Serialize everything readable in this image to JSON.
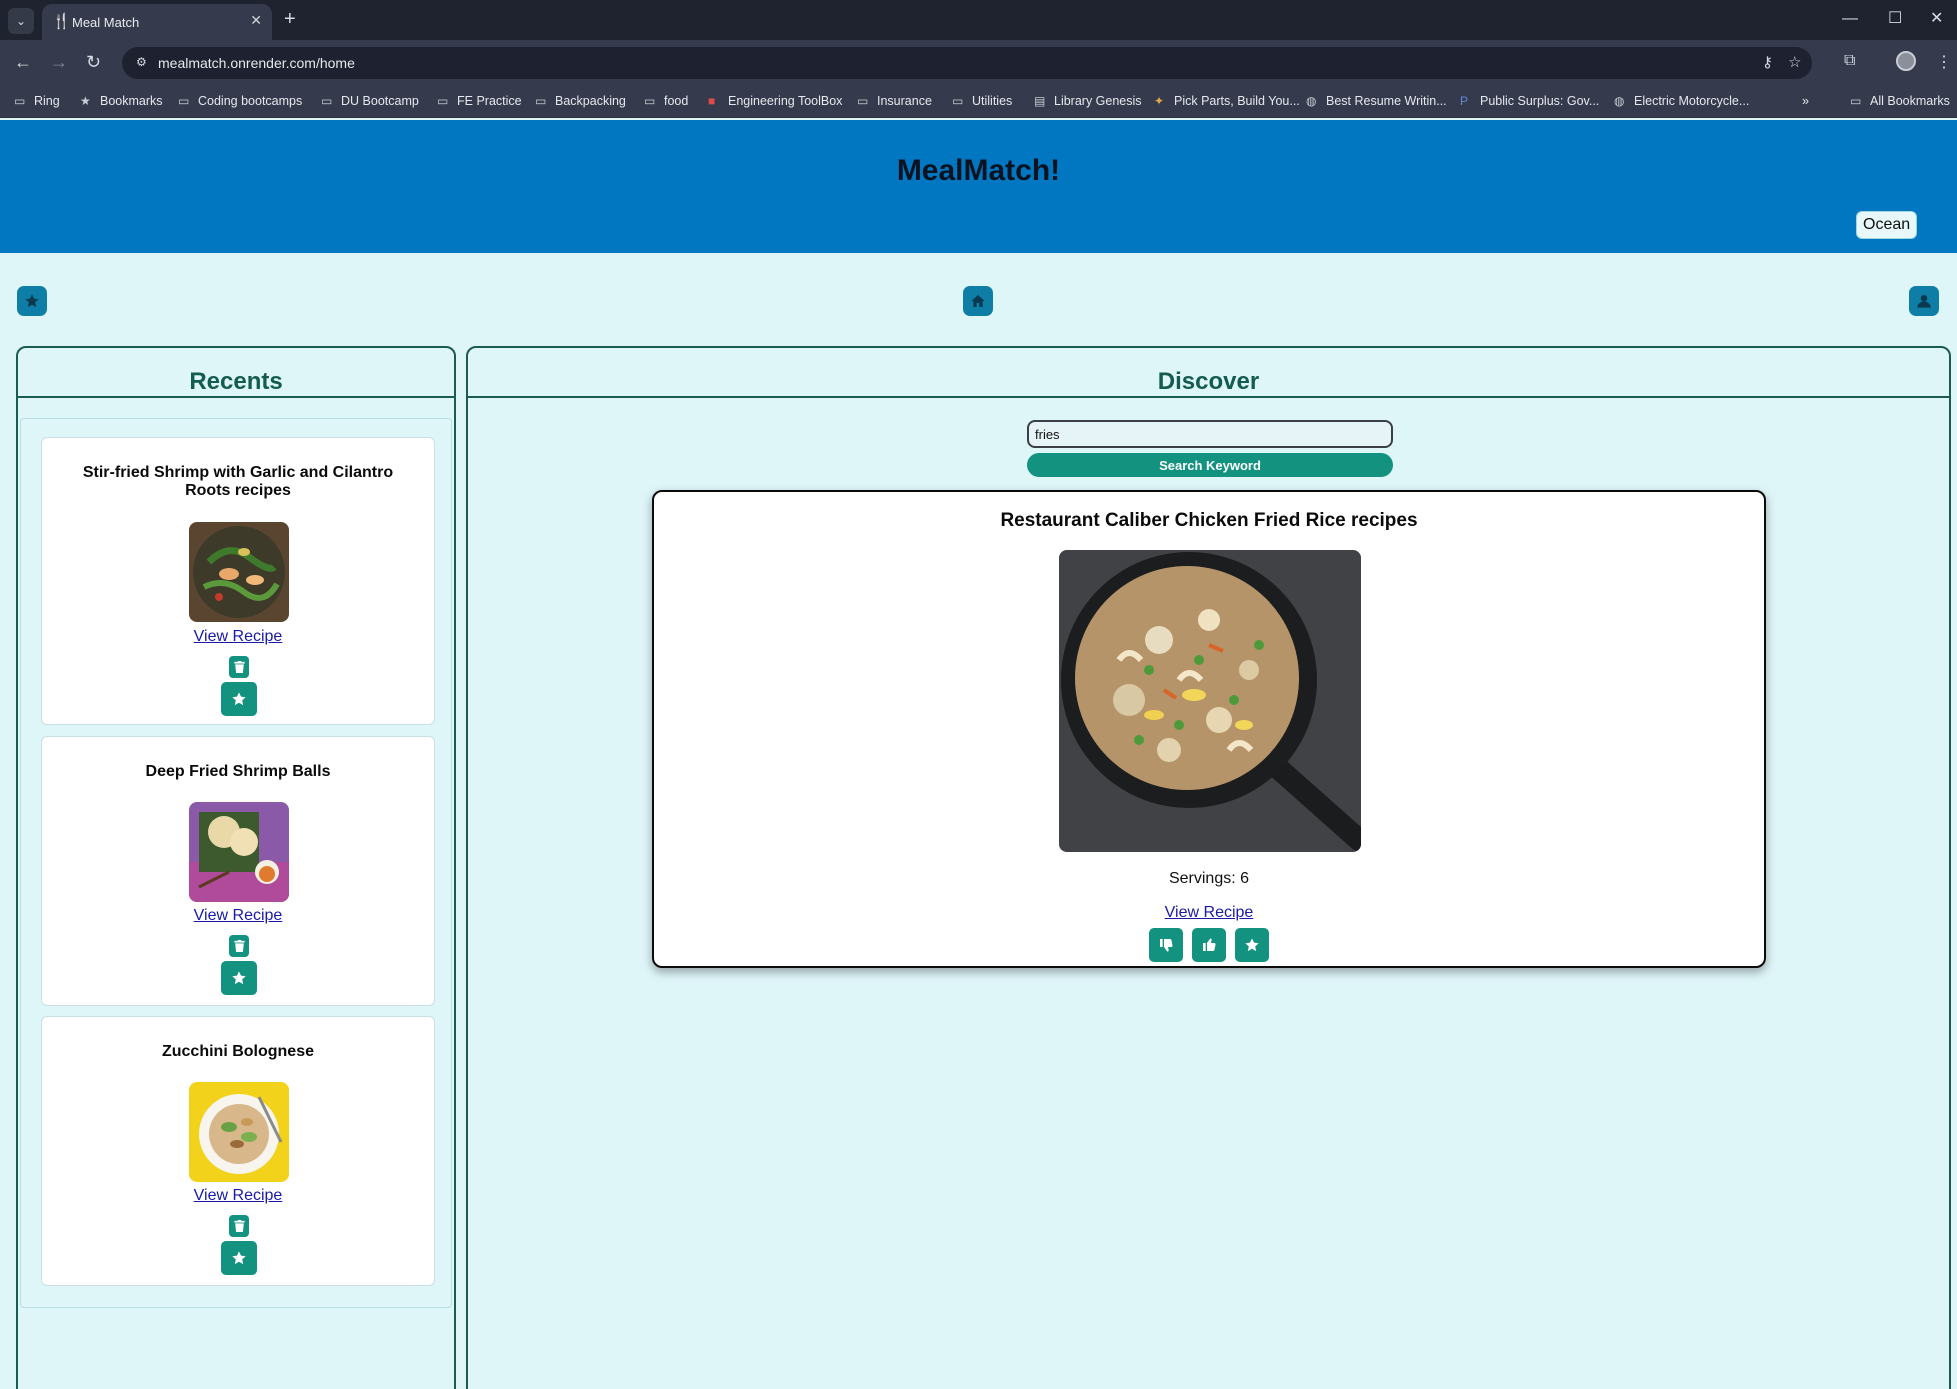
{
  "browser": {
    "tab_title": "Meal Match",
    "url": "mealmatch.onrender.com/home",
    "bookmarks": [
      {
        "label": "Ring",
        "icon": "folder-icon"
      },
      {
        "label": "Bookmarks",
        "icon": "star-icon"
      },
      {
        "label": "Coding bootcamps",
        "icon": "folder-icon"
      },
      {
        "label": "DU Bootcamp",
        "icon": "folder-icon"
      },
      {
        "label": "FE Practice",
        "icon": "folder-icon"
      },
      {
        "label": "Backpacking",
        "icon": "folder-icon"
      },
      {
        "label": "food",
        "icon": "folder-icon"
      },
      {
        "label": "Engineering ToolBox",
        "icon": "site-icon"
      },
      {
        "label": "Insurance",
        "icon": "folder-icon"
      },
      {
        "label": "Utilities",
        "icon": "folder-icon"
      },
      {
        "label": "Library Genesis",
        "icon": "site-icon"
      },
      {
        "label": "Pick Parts, Build You...",
        "icon": "site-icon"
      },
      {
        "label": "Best Resume Writin...",
        "icon": "globe-icon"
      },
      {
        "label": "Public Surplus: Gov...",
        "icon": "site-icon"
      },
      {
        "label": "Electric Motorcycle...",
        "icon": "globe-icon"
      }
    ],
    "all_bookmarks_label": "All Bookmarks"
  },
  "app": {
    "title": "MealMatch!",
    "theme_button": "Ocean",
    "colors": {
      "header": "#0077c0",
      "background": "#dff6f9",
      "accent": "#12927f",
      "panel_border": "#1b5b52"
    }
  },
  "recents": {
    "title": "Recents",
    "items": [
      {
        "title": "Stir-fried Shrimp with Garlic and Cilantro Roots recipes",
        "link": "View Recipe"
      },
      {
        "title": "Deep Fried Shrimp Balls",
        "link": "View Recipe"
      },
      {
        "title": "Zucchini Bolognese",
        "link": "View Recipe"
      }
    ]
  },
  "discover": {
    "title": "Discover",
    "search_value": "fries",
    "search_button": "Search Keyword",
    "card": {
      "title": "Restaurant Caliber Chicken Fried Rice recipes",
      "servings": "Servings: 6",
      "link": "View Recipe"
    }
  }
}
